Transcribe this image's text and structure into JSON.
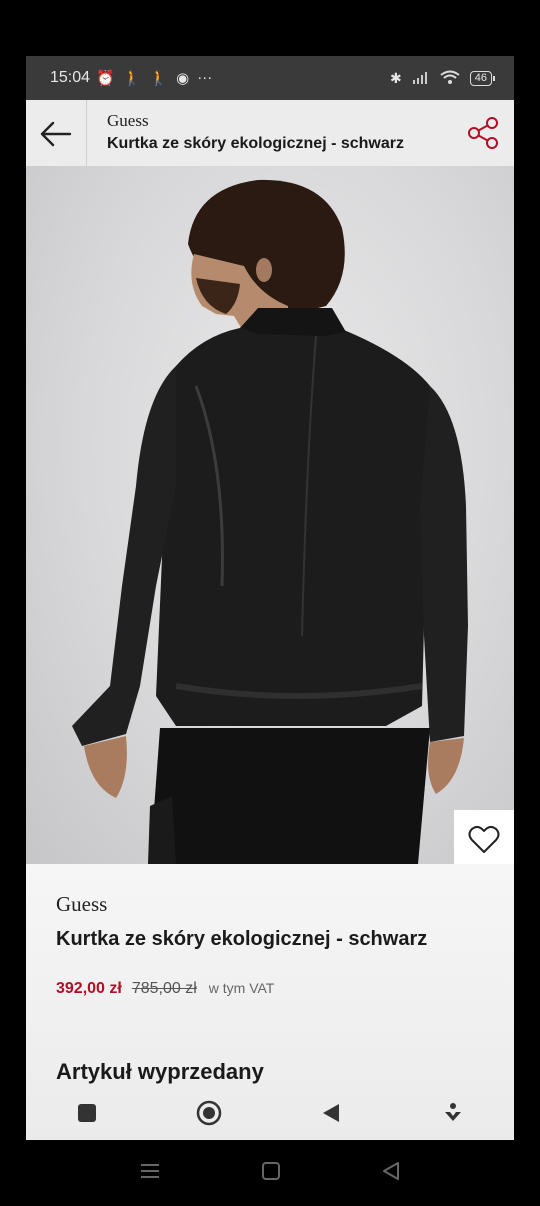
{
  "status_bar": {
    "time": "15:04",
    "battery": "46",
    "icons": [
      "alarm-icon",
      "walk-icon",
      "walk-icon",
      "shield-icon",
      "more-icon",
      "bluetooth-icon",
      "signal-icon",
      "wifi-icon",
      "battery-icon"
    ]
  },
  "header": {
    "brand": "Guess",
    "title": "Kurtka ze skóry ekologicznej - schwarz",
    "back_icon": "arrow-left-icon",
    "share_icon": "share-icon"
  },
  "product": {
    "brand": "Guess",
    "name": "Kurtka ze skóry ekologicznej - schwarz",
    "price_sale": "392,00 zł",
    "price_old": "785,00 zł",
    "vat_note": "w tym VAT",
    "availability": "Artykuł wyprzedany",
    "image_alt": "",
    "favorite_icon": "heart-icon"
  },
  "colors": {
    "sale_price": "#b30e26",
    "header_bg": "#ececec",
    "status_bg": "#3a3a3a"
  },
  "bottom_nav": {
    "icons": [
      "square-icon",
      "record-icon",
      "triangle-left-icon",
      "down-arrow-icon"
    ]
  },
  "system_nav": {
    "icons": [
      "menu-icon",
      "home-square-icon",
      "back-triangle-icon"
    ]
  }
}
